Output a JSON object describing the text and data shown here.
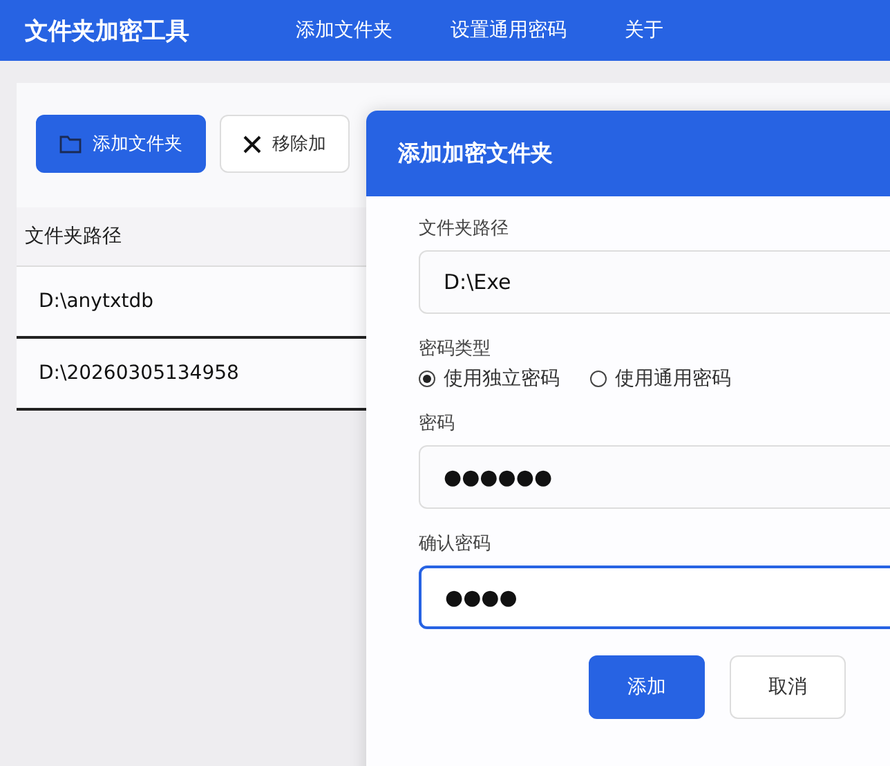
{
  "app": {
    "title": "文件夹加密工具"
  },
  "nav": [
    {
      "label": "添加文件夹"
    },
    {
      "label": "设置通用密码"
    },
    {
      "label": "关于"
    }
  ],
  "toolbar": [
    {
      "label": "添加文件夹",
      "kind": "primary"
    },
    {
      "label": "移除加",
      "kind": "remove"
    }
  ],
  "table": {
    "columns": [
      "文件夹路径"
    ],
    "rows": [
      "D:\\anytxtdb",
      "D:\\20260305134958"
    ]
  },
  "dialog": {
    "title": "添加加密文件夹",
    "fields": [
      {
        "kind": "text",
        "label": "文件夹路径",
        "value": "D:\\Exe",
        "focused": false
      },
      {
        "kind": "radio",
        "label": "密码类型",
        "options": [
          {
            "label": "使用独立密码",
            "selected": true
          },
          {
            "label": "使用通用密码",
            "selected": false
          }
        ]
      },
      {
        "kind": "password",
        "label": "密码",
        "value": "●●●●●●",
        "focused": false
      },
      {
        "kind": "password",
        "label": "确认密码",
        "value": "●●●●",
        "focused": true
      }
    ],
    "buttons": [
      {
        "label": "添加",
        "kind": "primary"
      },
      {
        "label": "取消",
        "kind": "secondary"
      }
    ]
  }
}
